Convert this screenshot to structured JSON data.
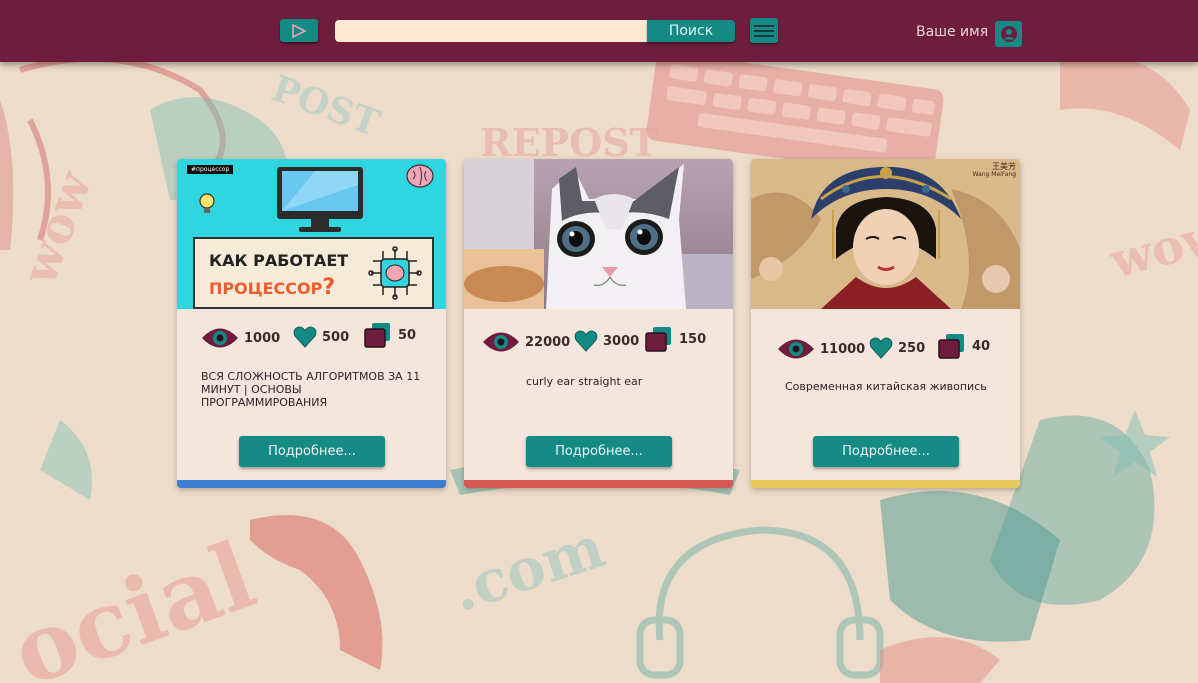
{
  "header": {
    "search_placeholder": "",
    "search_button": "Поиск",
    "user_name": "Ваше имя"
  },
  "cards": [
    {
      "thumb_tag": "#процессор",
      "thumb_line1": "КАК РАБОТАЕТ",
      "thumb_line2": "ПРОЦЕССОР",
      "thumb_q": "?",
      "views": "1000",
      "likes": "500",
      "reposts": "50",
      "description": "ВСЯ СЛОЖНОСТЬ АЛГОРИТМОВ ЗА 11 МИНУТ | ОСНОВЫ ПРОГРАММИРОВАНИЯ",
      "button": "Подробнее...",
      "accent": "#3f7fcf"
    },
    {
      "views": "22000",
      "likes": "3000",
      "reposts": "150",
      "description": "curly ear straight ear",
      "button": "Подробнее...",
      "accent": "#d55a55"
    },
    {
      "thumb_caption_cn": "王美芳",
      "thumb_caption_en": "Wang MeiFang",
      "views": "11000",
      "likes": "250",
      "reposts": "40",
      "description": "Современная китайская живопись",
      "button": "Подробнее...",
      "accent": "#e6c95a"
    }
  ],
  "background_words": [
    "POST",
    "REPOST",
    ".com",
    "ocial",
    "wow",
    "Social"
  ],
  "colors": {
    "header": "#6e1d3c",
    "teal": "#158a85",
    "maroon": "#6e1d3c",
    "card": "#f5e6dd"
  }
}
